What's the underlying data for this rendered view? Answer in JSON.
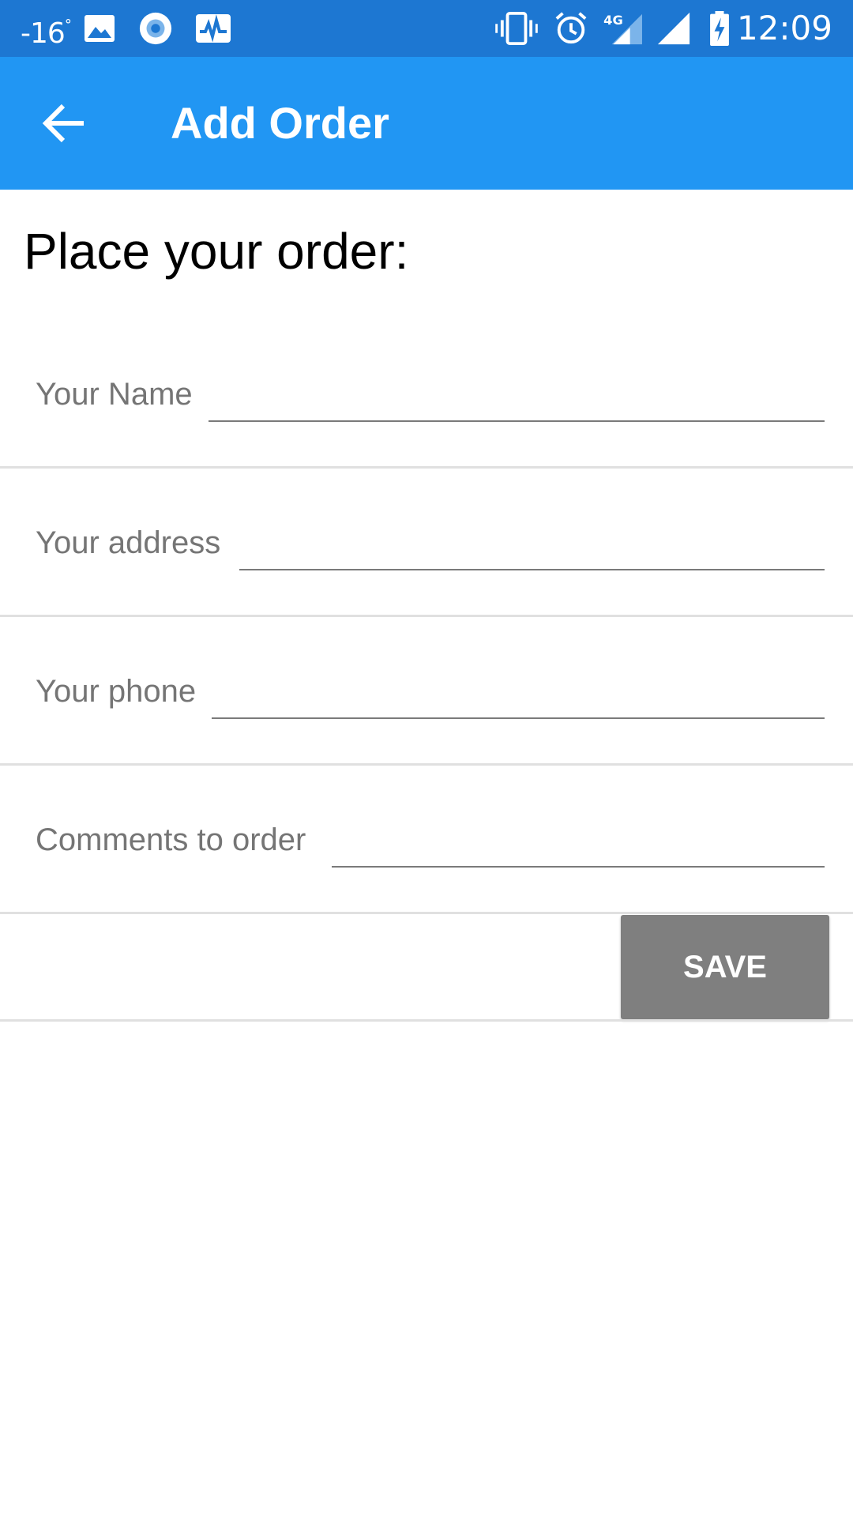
{
  "status_bar": {
    "temperature": "-16",
    "degree": "°",
    "network": "4G",
    "time": "12:09",
    "icons": [
      "image-icon",
      "circle-notification-icon",
      "activity-chart-icon",
      "vibrate-icon",
      "alarm-icon",
      "signal-4g-icon",
      "signal-icon",
      "battery-charging-icon"
    ]
  },
  "app_bar": {
    "back_icon": "arrow-left-icon",
    "title": "Add Order",
    "background": "#2196f3"
  },
  "form": {
    "heading": "Place your order:",
    "fields": [
      {
        "label": "Your Name",
        "value": ""
      },
      {
        "label": "Your address",
        "value": ""
      },
      {
        "label": "Your phone",
        "value": ""
      },
      {
        "label": "Comments to order",
        "value": ""
      }
    ],
    "save_label": "SAVE"
  }
}
